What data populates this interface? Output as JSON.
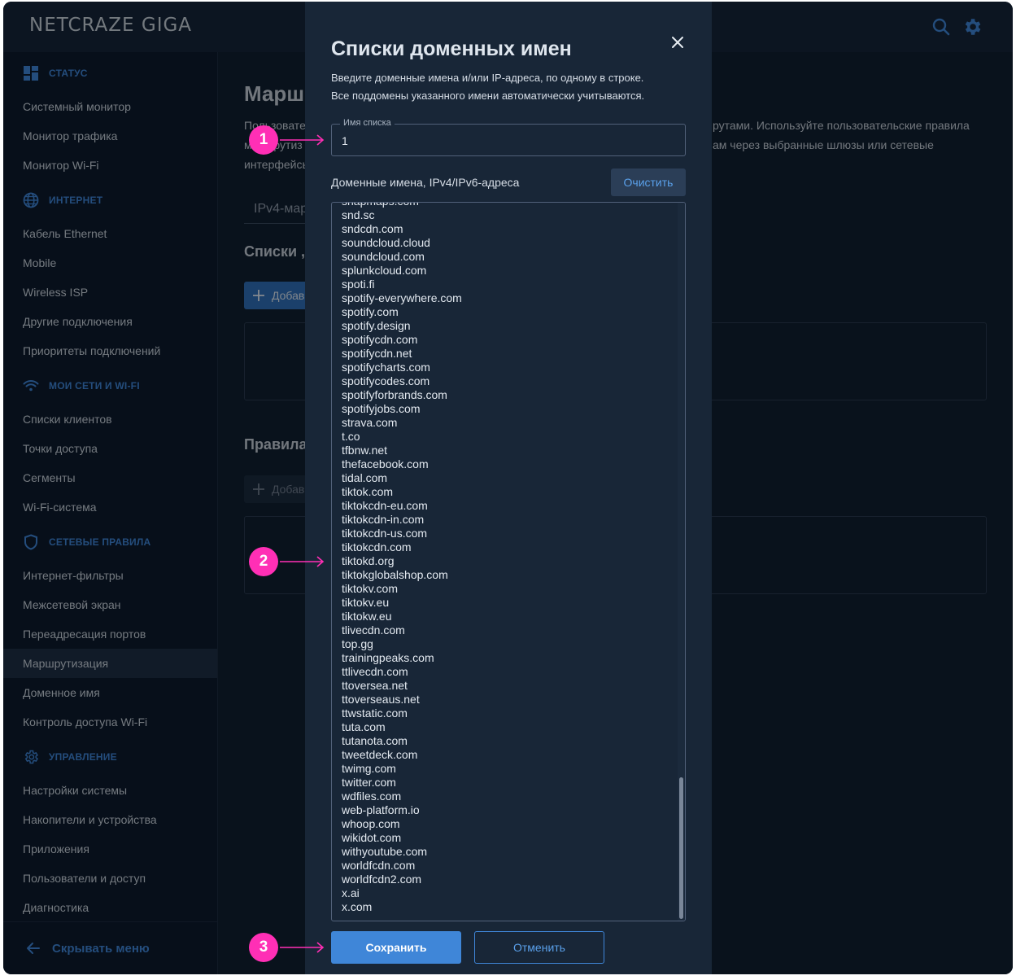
{
  "app": {
    "logo": "NETCRAZE GIGA"
  },
  "topbar": {
    "search_icon": "search-icon",
    "settings_icon": "gear-icon"
  },
  "colors": {
    "accent": "#3f86d8",
    "marker": "#ff2fb5"
  },
  "sidebar": {
    "sections": [
      {
        "title": "СТАТУС",
        "icon": "dashboard-icon",
        "items": [
          "Системный монитор",
          "Монитор трафика",
          "Монитор Wi-Fi"
        ]
      },
      {
        "title": "ИНТЕРНЕТ",
        "icon": "globe-icon",
        "items": [
          "Кабель Ethernet",
          "Mobile",
          "Wireless ISP",
          "Другие подключения",
          "Приоритеты подключений"
        ]
      },
      {
        "title": "МОИ СЕТИ И WI-FI",
        "icon": "wifi-icon",
        "items": [
          "Списки клиентов",
          "Точки доступа",
          "Сегменты",
          "Wi-Fi-система"
        ]
      },
      {
        "title": "СЕТЕВЫЕ ПРАВИЛА",
        "icon": "shield-icon",
        "items": [
          "Интернет-фильтры",
          "Межсетевой экран",
          "Переадресация портов",
          "Маршрутизация",
          "Доменное имя",
          "Контроль доступа Wi-Fi"
        ]
      },
      {
        "title": "УПРАВЛЕНИЕ",
        "icon": "gear-icon",
        "items": [
          "Настройки системы",
          "Накопители и устройства",
          "Приложения",
          "Пользователи и доступ",
          "Диагностика"
        ]
      }
    ],
    "active_item": "Маршрутизация",
    "hide_menu": "Скрывать меню"
  },
  "background": {
    "page_title": "Марш",
    "desc_left_1": "Пользовате",
    "desc_left_2": "маршрутиз",
    "desc_left_3": "интерфейсы",
    "desc_right_1": "рутами. Используйте пользовательские правила",
    "desc_right_2": "ам через выбранные шлюзы или сетевые",
    "tab": "IPv4-мар",
    "section1": "Списки ,",
    "add1": "Добав",
    "section2": "Правила",
    "add2": "Добав"
  },
  "modal": {
    "title": "Списки доменных имен",
    "desc1": "Введите доменные имена и/или IP-адреса, по одному в строке.",
    "desc2": "Все поддомены указанного имени автоматически учитываются.",
    "name_label": "Имя списка",
    "name_value": "1",
    "domains_label": "Доменные имена, IPv4/IPv6-адреса",
    "clear": "Очистить",
    "domains": [
      "snapmaps.com",
      "snd.sc",
      "sndcdn.com",
      "soundcloud.cloud",
      "soundcloud.com",
      "splunkcloud.com",
      "spoti.fi",
      "spotify-everywhere.com",
      "spotify.com",
      "spotify.design",
      "spotifycdn.com",
      "spotifycdn.net",
      "spotifycharts.com",
      "spotifycodes.com",
      "spotifyforbrands.com",
      "spotifyjobs.com",
      "strava.com",
      "t.co",
      "tfbnw.net",
      "thefacebook.com",
      "tidal.com",
      "tiktok.com",
      "tiktokcdn-eu.com",
      "tiktokcdn-in.com",
      "tiktokcdn-us.com",
      "tiktokcdn.com",
      "tiktokd.org",
      "tiktokglobalshop.com",
      "tiktokv.com",
      "tiktokv.eu",
      "tiktokw.eu",
      "tlivecdn.com",
      "top.gg",
      "trainingpeaks.com",
      "ttlivecdn.com",
      "ttoversea.net",
      "ttoverseaus.net",
      "ttwstatic.com",
      "tuta.com",
      "tutanota.com",
      "tweetdeck.com",
      "twimg.com",
      "twitter.com",
      "wdfiles.com",
      "web-platform.io",
      "whoop.com",
      "wikidot.com",
      "withyoutube.com",
      "worldfcdn.com",
      "worldfcdn2.com",
      "x.ai",
      "x.com"
    ],
    "save": "Сохранить",
    "cancel": "Отменить"
  },
  "markers": [
    "1",
    "2",
    "3"
  ]
}
